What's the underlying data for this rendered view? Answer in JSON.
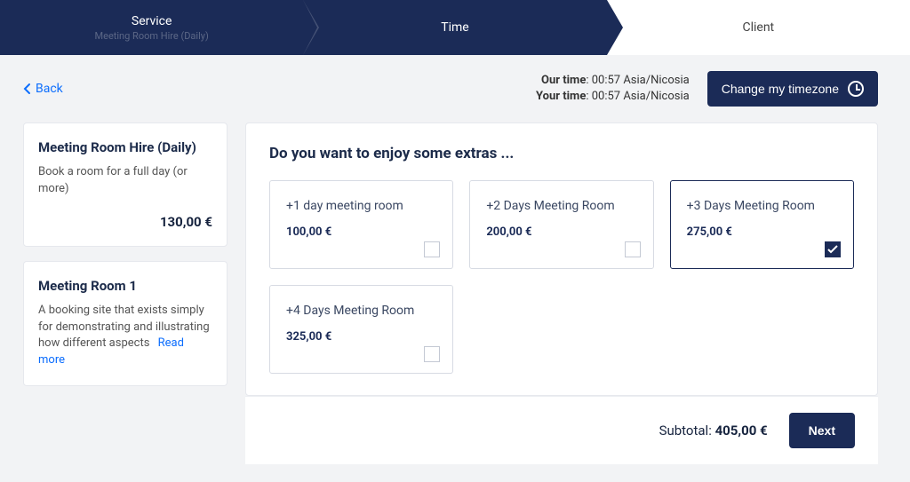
{
  "stepper": {
    "steps": [
      {
        "label": "Service",
        "sub": "Meeting Room Hire (Daily)"
      },
      {
        "label": "Time"
      },
      {
        "label": "Client"
      }
    ]
  },
  "back_label": "Back",
  "timezone": {
    "our_label": "Our time",
    "our_value": "00:57 Asia/Nicosia",
    "your_label": "Your time",
    "your_value": "00:57 Asia/Nicosia",
    "button": "Change my timezone"
  },
  "sidebar": {
    "cards": [
      {
        "title": "Meeting Room Hire (Daily)",
        "desc": "Book a room for a full day (or more)",
        "price": "130,00 €"
      },
      {
        "title": "Meeting Room 1",
        "desc": "A booking site that exists simply for demonstrating and illustrating how different aspects",
        "readmore": "Read more"
      }
    ]
  },
  "main": {
    "heading": "Do you want to enjoy some extras ...",
    "extras": [
      {
        "title": "+1 day meeting room",
        "price": "100,00 €",
        "selected": false
      },
      {
        "title": "+2 Days Meeting Room",
        "price": "200,00 €",
        "selected": false
      },
      {
        "title": "+3 Days Meeting Room",
        "price": "275,00 €",
        "selected": true
      },
      {
        "title": "+4 Days Meeting Room",
        "price": "325,00 €",
        "selected": false
      }
    ]
  },
  "footer": {
    "subtotal_label": "Subtotal:",
    "subtotal_value": "405,00 €",
    "next": "Next"
  }
}
